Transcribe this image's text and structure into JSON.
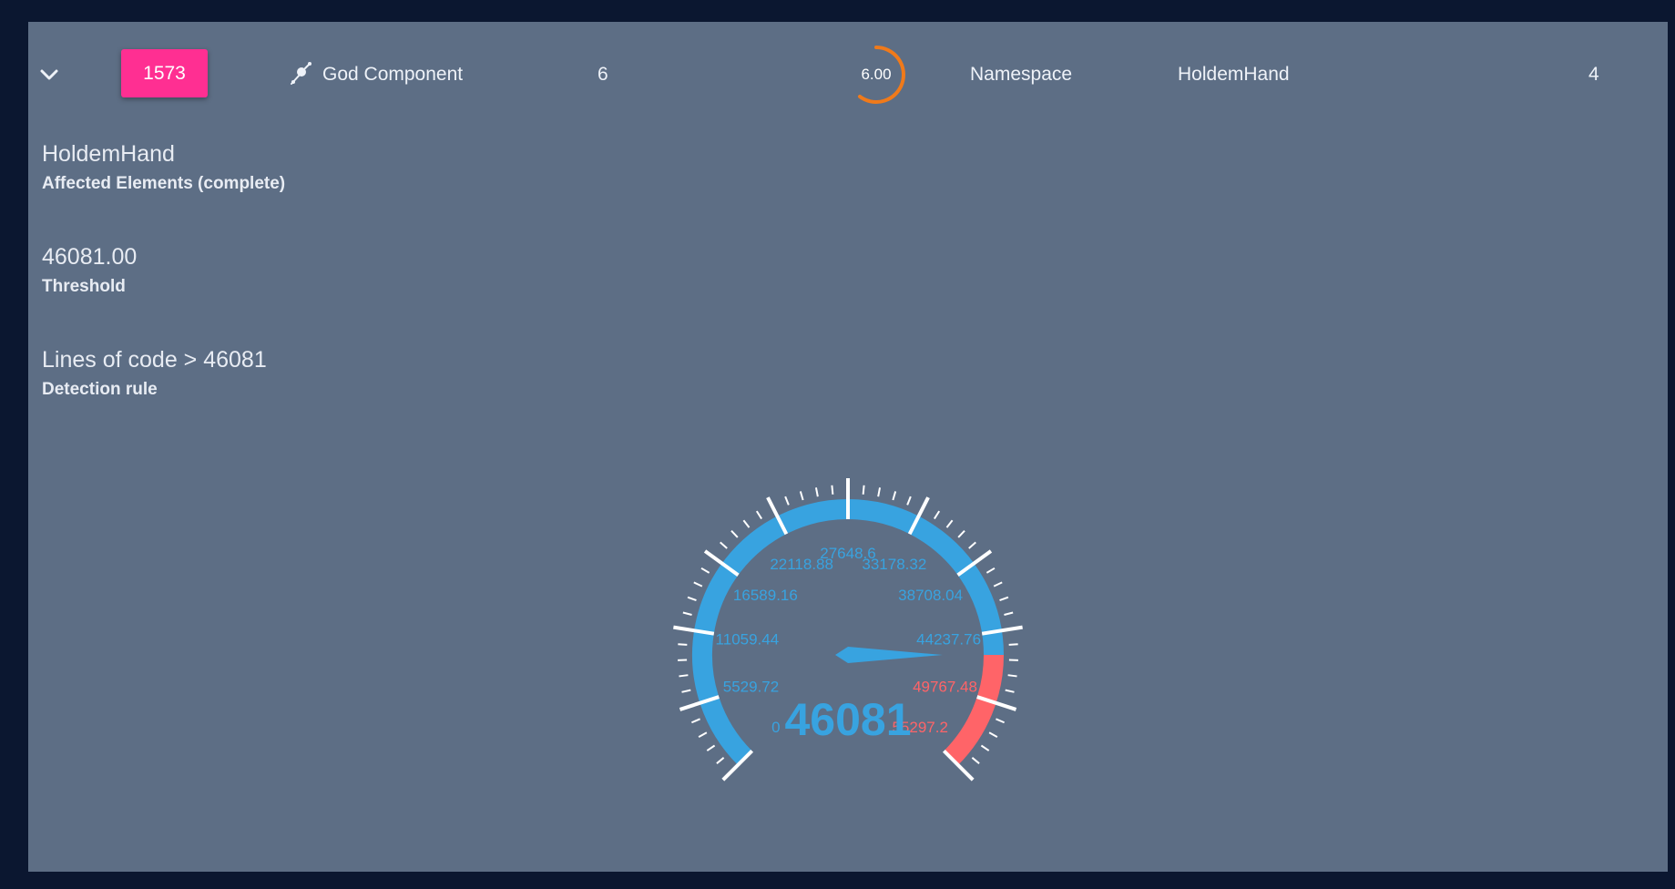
{
  "row": {
    "id_badge": "1573",
    "issue_type": "God Component",
    "count": "6",
    "severity": "6.00",
    "element_kind": "Namespace",
    "element_name": "HoldemHand",
    "last_col": "4"
  },
  "details": {
    "title": "HoldemHand",
    "affected_label": "Affected Elements (complete)",
    "threshold_value": "46081.00",
    "threshold_label": "Threshold",
    "rule_value": "Lines of code > 46081",
    "rule_label": "Detection rule"
  },
  "gauge": {
    "value": 46081,
    "value_text": "46081",
    "min": 0,
    "max": 55297.2,
    "threshold": 46081,
    "ticks": [
      "0",
      "5529.72",
      "11059.44",
      "16589.16",
      "22118.88",
      "27648.6",
      "33178.32",
      "38708.04",
      "44237.76",
      "49767.48",
      "55297.2"
    ]
  },
  "colors": {
    "background": "#0b1730",
    "panel": "#5d6e85",
    "badge": "#ff2f92",
    "ring": "#f07a1a",
    "gauge_normal": "#38a3e0",
    "gauge_danger": "#ff6468",
    "text": "#eef2f8"
  },
  "icons": {
    "chevron": "chevron-down-icon",
    "issue_type": "satellite-icon"
  }
}
